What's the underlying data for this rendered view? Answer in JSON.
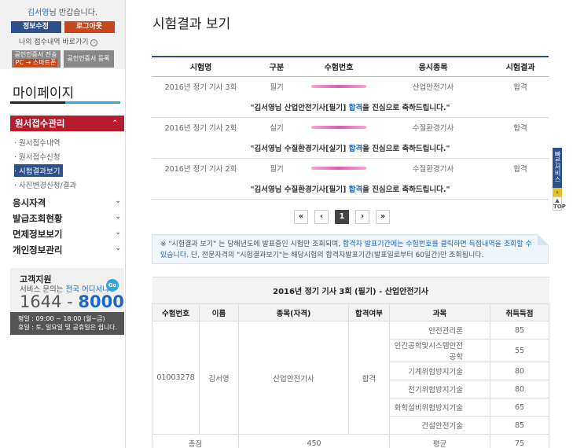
{
  "user": {
    "name": "김서영",
    "greeting_suffix": "님 반갑습니다.",
    "info_button": "정보수정",
    "logout_button": "로그아웃",
    "shortcut": "나의 접수내역 바로가기",
    "cert_register_a": "공인인증서 전송",
    "cert_register_a_sub": "PC → 스마트폰",
    "cert_register_b": "공인인증서 등록"
  },
  "sidebar": {
    "title": "마이페이지",
    "section_head": "원서접수관리",
    "sub_items": [
      "원서접수내역",
      "원서접수신청",
      "시험결과보기",
      "사진변경신청/결과"
    ],
    "menu": [
      "응시자격",
      "발급조회현황",
      "면제정보보기",
      "개인정보관리"
    ]
  },
  "support": {
    "title": "고객지원",
    "desc_prefix": "서비스 문의는 ",
    "desc_highlight": "전국 어디서나",
    "go": "Go",
    "num_prefix": "1644 - ",
    "num_highlight": "8000",
    "hours_line1": "평일 : 09:00 ~ 18:00 (월~금)",
    "hours_line2": "휴일 : 토, 일요일 및 공휴일은 쉽니다."
  },
  "main": {
    "title": "시험결과 보기",
    "columns": [
      "시험명",
      "구분",
      "수험번호",
      "응시종목",
      "시험결과"
    ],
    "results": [
      {
        "exam": "2016년 정기 기사 3회",
        "type": "필기",
        "subject": "산업안전기사",
        "result": "합격",
        "msg_a": "\"김서영님 산업안전기사[필기] ",
        "msg_b": "합격",
        "msg_c": "을 진심으로 축하드립니다.\""
      },
      {
        "exam": "2016년 정기 기사 2회",
        "type": "실기",
        "subject": "수질환경기사",
        "result": "합격",
        "msg_a": "\"김서영님 수질환경기사[실기] ",
        "msg_b": "합격",
        "msg_c": "을 진심으로 축하드립니다.\""
      },
      {
        "exam": "2016년 정기 기사 2회",
        "type": "필기",
        "subject": "수질환경기사",
        "result": "합격",
        "msg_a": "\"김서영님 수질환경기사[필기] ",
        "msg_b": "합격",
        "msg_c": "을 진심으로 축하드립니다.\""
      }
    ],
    "pager": {
      "first": "«",
      "prev": "‹",
      "current": "1",
      "next": "›",
      "last": "»"
    },
    "notice_a": "※ \"시험결과 보기\" 는 당해년도에 발표중인 시험만 조회되며, ",
    "notice_b": "합격자 발표기간에는 수험번호를 클릭하면 득점내역을 조회할 수 있습니다.",
    "notice_c": " 단, 전문자격의 \"시험결과보기\"는 해당시험의 합격자발표기간(발표일로부터 60일간)만 조회됩니다."
  },
  "detail": {
    "caption": "2016년 정기 기사 3회 (필기) - 산업안전기사",
    "columns": [
      "수험번호",
      "이름",
      "종목(자격)",
      "합격여부",
      "과목",
      "취득득점"
    ],
    "exam_no": "01003278",
    "name": "김서영",
    "qualification": "산업안전기사",
    "pass": "합격",
    "subjects": [
      {
        "name": "안전관리론",
        "score": "85"
      },
      {
        "name": "인간공학및시스템안전공학",
        "score": "55"
      },
      {
        "name": "기계위험방지기술",
        "score": "80"
      },
      {
        "name": "전기위험방지기술",
        "score": "80"
      },
      {
        "name": "화학설비위험방지기술",
        "score": "65"
      },
      {
        "name": "건설안전기술",
        "score": "85"
      }
    ],
    "total_label": "총점",
    "total_value": "450",
    "avg_label": "평균",
    "avg_value": "75"
  },
  "floating": {
    "quick": "빠른서비스",
    "top": "TOP"
  }
}
